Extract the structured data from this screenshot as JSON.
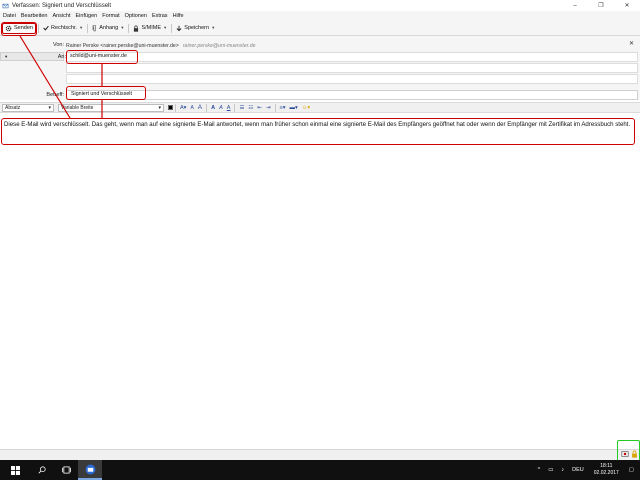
{
  "window": {
    "title": "Verfassen: Signiert und Verschlüsselt",
    "controls": [
      "minimize-icon",
      "restore-icon",
      "close-icon"
    ]
  },
  "menubar": {
    "items": [
      "Datei",
      "Bearbeiten",
      "Ansicht",
      "Einfügen",
      "Format",
      "Optionen",
      "Extras",
      "Hilfe"
    ]
  },
  "toolbar": {
    "send_label": "Senden",
    "spell_label": "Rechtschr.",
    "attach_label": "Anhang",
    "smime_label": "S/MIME",
    "save_label": "Speichern"
  },
  "header": {
    "from_label": "Von:",
    "from_name": "Rainer Perske <rainer.perske@uni-muenster.de>",
    "from_email": "rainer.perske@uni-muenster.de",
    "to_type": "An:",
    "to_value": "schild@uni-muenster.de",
    "subject_label": "Betreff:",
    "subject_value": "Signiert und Verschlüsselt"
  },
  "format": {
    "paragraph": "Absatz",
    "font": "Variable Breite"
  },
  "body": {
    "text": "Diese E-Mail wird verschlüsselt. Das geht, wenn man auf eine signierte E-Mail antwortet, wenn man früher schon einmal eine signierte E-Mail des Empfängers geöffnet hat oder wenn der Empfänger mit Zertifikat im Adressbuch steht."
  },
  "taskbar": {
    "language": "DEU",
    "time": "18:11",
    "date": "02.02.2017"
  },
  "colors": {
    "annotation": "#d00000",
    "annotation_green": "#22cc22",
    "taskbar": "#101010"
  }
}
